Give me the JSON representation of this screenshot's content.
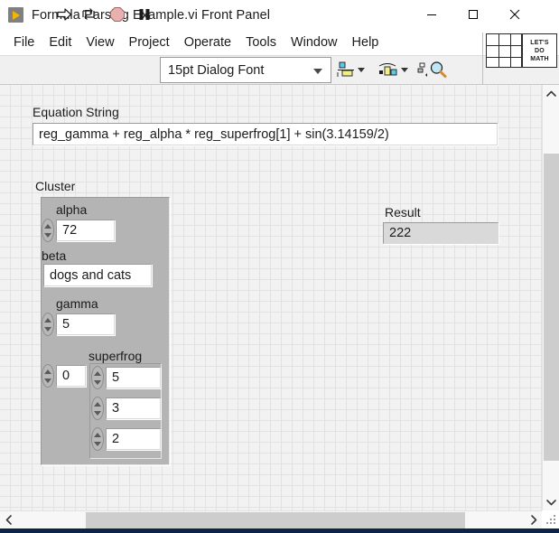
{
  "window": {
    "title": "Formula Parsing Example.vi Front Panel",
    "icon": "labview-vi-icon",
    "controls": {
      "minimize": "minimize-icon",
      "maximize": "maximize-icon",
      "close": "close-icon"
    }
  },
  "menubar": {
    "items": [
      {
        "label": "File"
      },
      {
        "label": "Edit"
      },
      {
        "label": "View"
      },
      {
        "label": "Project"
      },
      {
        "label": "Operate"
      },
      {
        "label": "Tools"
      },
      {
        "label": "Window"
      },
      {
        "label": "Help"
      }
    ]
  },
  "toolbar": {
    "run": "run-arrow-icon",
    "run_continuously": "run-continuously-icon",
    "abort": "abort-execution-icon",
    "pause": "pause-icon",
    "font_selector": {
      "value": "15pt Dialog Font",
      "caret": "chevron-down-icon"
    },
    "align_objects": "align-objects-icon",
    "distribute_objects": "distribute-objects-icon",
    "reorder": "reorder-icon",
    "search": "search-icon",
    "context_help": "context-help-icon"
  },
  "math_widget": {
    "grid_icon": "grid-icon",
    "text_lines": [
      "LET'S",
      "DO",
      "MATH"
    ]
  },
  "panel": {
    "equation": {
      "label": "Equation String",
      "value": "reg_gamma + reg_alpha * reg_superfrog[1] + sin(3.14159/2)"
    },
    "cluster": {
      "label": "Cluster",
      "fields": [
        {
          "name": "alpha",
          "label": "alpha",
          "type": "numeric",
          "value": "72"
        },
        {
          "name": "beta",
          "label": "beta",
          "type": "string",
          "value": "dogs and cats"
        },
        {
          "name": "gamma",
          "label": "gamma",
          "type": "numeric",
          "value": "5"
        }
      ],
      "array": {
        "label": "superfrog",
        "index": "0",
        "elements": [
          "5",
          "3",
          "2"
        ]
      }
    },
    "result": {
      "label": "Result",
      "value": "222"
    }
  },
  "scrollbars": {
    "vertical": {
      "up": "chevron-up-icon",
      "down": "chevron-down-icon"
    },
    "horizontal": {
      "left": "chevron-left-icon",
      "right": "chevron-right-icon"
    },
    "resize_grip": "resize-grip-icon"
  },
  "colors": {
    "canvas": "#f2f2f2",
    "grid_line": "#e2e2e2",
    "cluster_bg": "#b4b4b4",
    "control_bg": "#ffffff",
    "indicator_bg": "#d9d9d9",
    "accent_blue": "#0b2545",
    "vi_icon_yellow": "#f5b400"
  }
}
